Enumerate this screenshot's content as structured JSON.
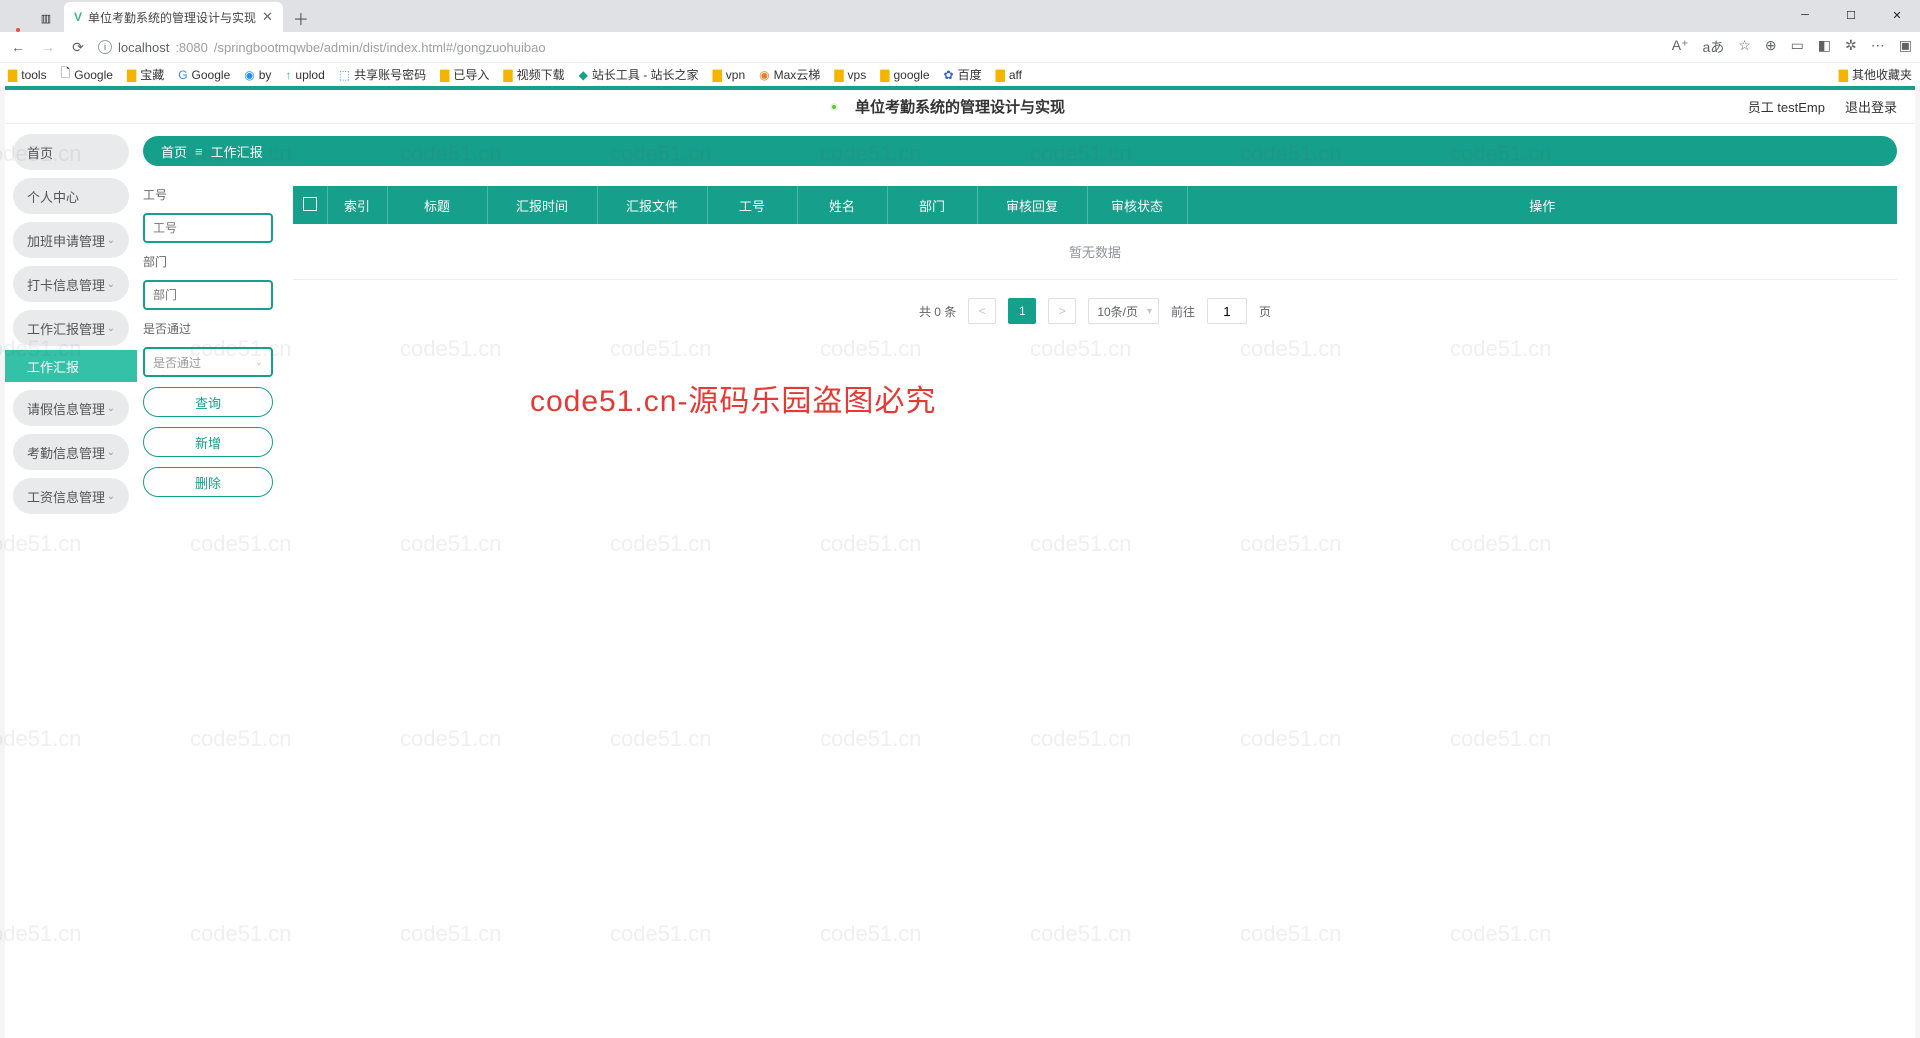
{
  "browser": {
    "tab_title": "单位考勤系统的管理设计与实现",
    "url_host": "localhost",
    "url_port": ":8080",
    "url_path": "/springbootmqwbe/admin/dist/index.html#/gongzuohuibao",
    "bookmarks": [
      "tools",
      "Google",
      "宝藏",
      "Google",
      "by",
      "uplod",
      "共享账号密码",
      "已导入",
      "视频下载",
      "站长工具 - 站长之家",
      "vpn",
      "Max云梯",
      "vps",
      "google",
      "百度",
      "aff"
    ],
    "bookmarks_right": "其他收藏夹"
  },
  "header": {
    "app_title": "单位考勤系统的管理设计与实现",
    "user_label": "员工 testEmp",
    "logout": "退出登录"
  },
  "sidebar": {
    "items": [
      {
        "label": "首页",
        "chevron": false
      },
      {
        "label": "个人中心",
        "chevron": false
      },
      {
        "label": "加班申请管理",
        "chevron": true
      },
      {
        "label": "打卡信息管理",
        "chevron": true
      },
      {
        "label": "工作汇报管理",
        "chevron": true
      },
      {
        "label": "工作汇报",
        "sub": true
      },
      {
        "label": "请假信息管理",
        "chevron": true
      },
      {
        "label": "考勤信息管理",
        "chevron": true
      },
      {
        "label": "工资信息管理",
        "chevron": true
      }
    ]
  },
  "breadcrumb": {
    "home": "首页",
    "current": "工作汇报"
  },
  "filters": {
    "f1_label": "工号",
    "f1_placeholder": "工号",
    "f2_label": "部门",
    "f2_placeholder": "部门",
    "f3_label": "是否通过",
    "f3_placeholder": "是否通过",
    "btn_search": "查询",
    "btn_add": "新增",
    "btn_delete": "删除"
  },
  "table": {
    "columns": [
      "",
      "索引",
      "标题",
      "汇报时间",
      "汇报文件",
      "工号",
      "姓名",
      "部门",
      "审核回复",
      "审核状态",
      "操作"
    ],
    "empty_text": "暂无数据"
  },
  "pagination": {
    "total_text": "共 0 条",
    "page": "1",
    "per_page": "10条/页",
    "goto_prefix": "前往",
    "goto_value": "1",
    "goto_suffix": "页"
  },
  "watermark": {
    "text": "code51.cn",
    "center": "code51.cn-源码乐园盗图必究"
  }
}
